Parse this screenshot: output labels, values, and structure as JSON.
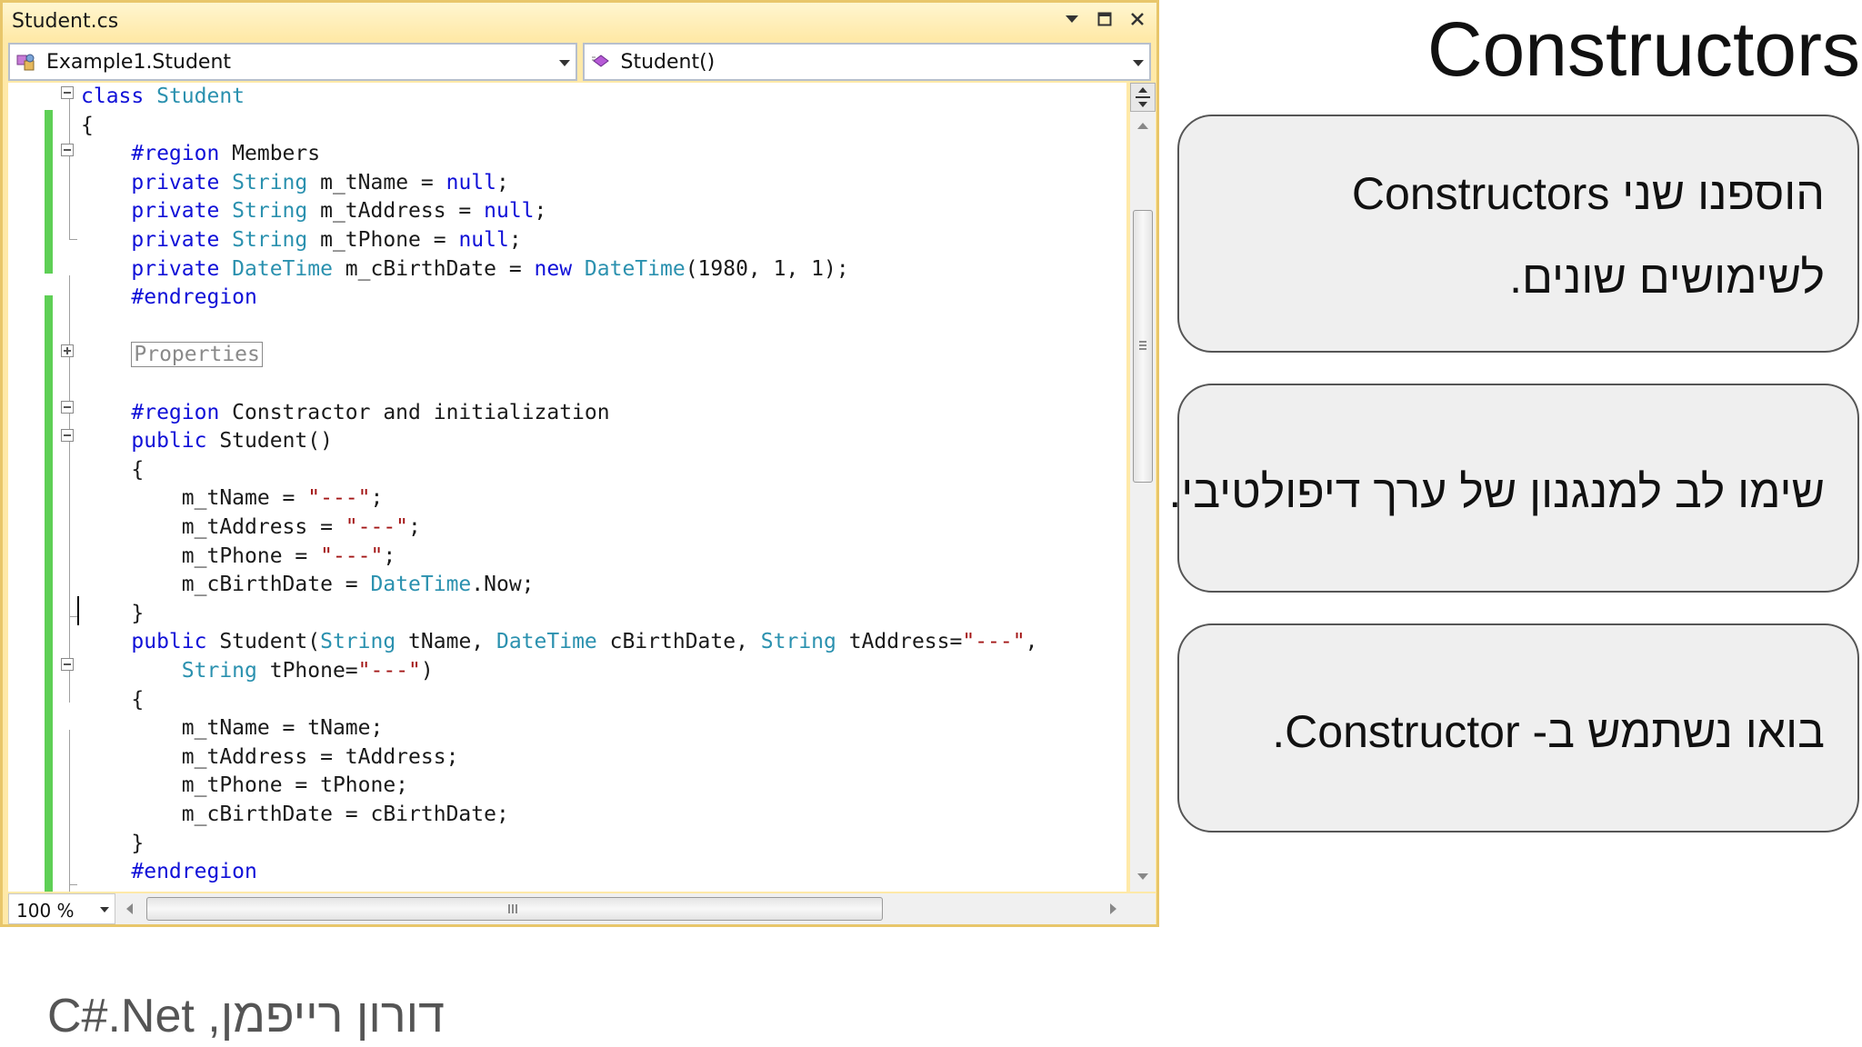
{
  "ide": {
    "window_title": "Student.cs",
    "class_combo": "Example1.Student",
    "member_combo": "Student()",
    "zoom_level": "100 %"
  },
  "code_lines": [
    [
      {
        "t": "class ",
        "c": "kw"
      },
      {
        "t": "Student",
        "c": "ty"
      }
    ],
    [
      {
        "t": "{",
        "c": ""
      }
    ],
    [
      {
        "t": "    #region ",
        "c": "kw"
      },
      {
        "t": "Members",
        "c": ""
      }
    ],
    [
      {
        "t": "    private ",
        "c": "kw"
      },
      {
        "t": "String",
        "c": "ty"
      },
      {
        "t": " m_tName = ",
        "c": ""
      },
      {
        "t": "null",
        "c": "kw"
      },
      {
        "t": ";",
        "c": ""
      }
    ],
    [
      {
        "t": "    private ",
        "c": "kw"
      },
      {
        "t": "String",
        "c": "ty"
      },
      {
        "t": " m_tAddress = ",
        "c": ""
      },
      {
        "t": "null",
        "c": "kw"
      },
      {
        "t": ";",
        "c": ""
      }
    ],
    [
      {
        "t": "    private ",
        "c": "kw"
      },
      {
        "t": "String",
        "c": "ty"
      },
      {
        "t": " m_tPhone = ",
        "c": ""
      },
      {
        "t": "null",
        "c": "kw"
      },
      {
        "t": ";",
        "c": ""
      }
    ],
    [
      {
        "t": "    private ",
        "c": "kw"
      },
      {
        "t": "DateTime",
        "c": "ty"
      },
      {
        "t": " m_cBirthDate = ",
        "c": ""
      },
      {
        "t": "new ",
        "c": "kw"
      },
      {
        "t": "DateTime",
        "c": "ty"
      },
      {
        "t": "(1980, 1, 1);",
        "c": ""
      }
    ],
    [
      {
        "t": "    #endregion",
        "c": "kw"
      }
    ],
    [],
    [
      {
        "t": "    ",
        "c": ""
      },
      {
        "t": "Properties",
        "c": "collapsed"
      }
    ],
    [],
    [
      {
        "t": "    #region ",
        "c": "kw"
      },
      {
        "t": "Constractor and initialization",
        "c": ""
      }
    ],
    [
      {
        "t": "    public ",
        "c": "kw"
      },
      {
        "t": "Student()",
        "c": ""
      }
    ],
    [
      {
        "t": "    {",
        "c": ""
      }
    ],
    [
      {
        "t": "        m_tName = ",
        "c": ""
      },
      {
        "t": "\"---\"",
        "c": "st"
      },
      {
        "t": ";",
        "c": ""
      }
    ],
    [
      {
        "t": "        m_tAddress = ",
        "c": ""
      },
      {
        "t": "\"---\"",
        "c": "st"
      },
      {
        "t": ";",
        "c": ""
      }
    ],
    [
      {
        "t": "        m_tPhone = ",
        "c": ""
      },
      {
        "t": "\"---\"",
        "c": "st"
      },
      {
        "t": ";",
        "c": ""
      }
    ],
    [
      {
        "t": "        m_cBirthDate = ",
        "c": ""
      },
      {
        "t": "DateTime",
        "c": "ty"
      },
      {
        "t": ".Now;",
        "c": ""
      }
    ],
    [
      {
        "t": "    }",
        "c": ""
      }
    ],
    [
      {
        "t": "    public ",
        "c": "kw"
      },
      {
        "t": "Student(",
        "c": ""
      },
      {
        "t": "String",
        "c": "ty"
      },
      {
        "t": " tName, ",
        "c": ""
      },
      {
        "t": "DateTime",
        "c": "ty"
      },
      {
        "t": " cBirthDate, ",
        "c": ""
      },
      {
        "t": "String",
        "c": "ty"
      },
      {
        "t": " tAddress=",
        "c": ""
      },
      {
        "t": "\"---\"",
        "c": "st"
      },
      {
        "t": ",",
        "c": ""
      }
    ],
    [
      {
        "t": "        ",
        "c": ""
      },
      {
        "t": "String",
        "c": "ty"
      },
      {
        "t": " tPhone=",
        "c": ""
      },
      {
        "t": "\"---\"",
        "c": "st"
      },
      {
        "t": ")",
        "c": ""
      }
    ],
    [
      {
        "t": "    {",
        "c": ""
      }
    ],
    [
      {
        "t": "        m_tName = tName;",
        "c": ""
      }
    ],
    [
      {
        "t": "        m_tAddress = tAddress;",
        "c": ""
      }
    ],
    [
      {
        "t": "        m_tPhone = tPhone;",
        "c": ""
      }
    ],
    [
      {
        "t": "        m_cBirthDate = cBirthDate;",
        "c": ""
      }
    ],
    [
      {
        "t": "    }",
        "c": ""
      }
    ],
    [
      {
        "t": "    #endregion",
        "c": "kw"
      }
    ]
  ],
  "slide": {
    "title": "Constructors",
    "box1_line1": "הוספנו שני Constructors",
    "box1_line2": "לשימושים שונים.",
    "box2_line1": "שימו לב למנגנון של ערך דיפולטיבי.",
    "box3_line1": "בואו נשתמש ב- Constructor.",
    "footer": "דורון רייפמן, C#.Net"
  },
  "colors": {
    "keyword": "#1010d8",
    "type": "#2b91af",
    "string": "#a31515",
    "change_bar": "#5ecf55",
    "window_frame": "#ffe9a8"
  }
}
